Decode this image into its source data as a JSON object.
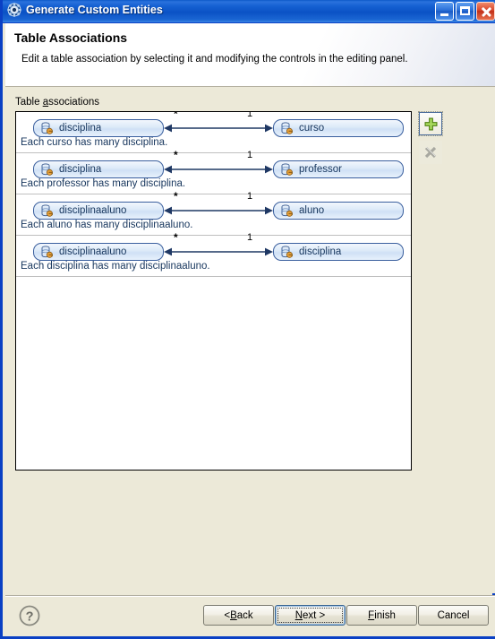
{
  "window": {
    "title": "Generate Custom Entities",
    "icon": "gear-icon",
    "minimize_label": "Minimize",
    "maximize_label": "Maximize",
    "close_label": "Close"
  },
  "banner": {
    "title": "Table Associations",
    "description": "Edit a table association by selecting it and modifying the controls in the editing panel."
  },
  "group": {
    "label_prefix": "Table ",
    "label_mnemonic": "a",
    "label_suffix": "ssociations"
  },
  "associations": [
    {
      "left_entity": "disciplina",
      "right_entity": "curso",
      "left_cardinality": "*",
      "right_cardinality": "1",
      "description": "Each curso has many disciplina."
    },
    {
      "left_entity": "disciplina",
      "right_entity": "professor",
      "left_cardinality": "*",
      "right_cardinality": "1",
      "description": "Each professor has many disciplina."
    },
    {
      "left_entity": "disciplinaaluno",
      "right_entity": "aluno",
      "left_cardinality": "*",
      "right_cardinality": "1",
      "description": "Each aluno has many disciplinaaluno."
    },
    {
      "left_entity": "disciplinaaluno",
      "right_entity": "disciplina",
      "left_cardinality": "*",
      "right_cardinality": "1",
      "description": "Each disciplina has many disciplinaaluno."
    }
  ],
  "side_tools": {
    "add": {
      "name": "add-association-button",
      "icon": "plus-icon",
      "enabled": true
    },
    "remove": {
      "name": "remove-association-button",
      "icon": "x-icon",
      "enabled": false
    }
  },
  "buttons": {
    "help": "?",
    "back_prefix": "< ",
    "back_mnemonic": "B",
    "back_suffix": "ack",
    "next_mnemonic": "N",
    "next_suffix": "ext >",
    "finish_mnemonic": "F",
    "finish_suffix": "inish",
    "cancel": "Cancel"
  },
  "colors": {
    "titlebar_blue": "#0b52c5",
    "window_border": "#0a40c4",
    "dialog_bg": "#ece9d8",
    "entity_border": "#3a5f9e",
    "entity_text": "#17365d",
    "arrow": "#1f3864",
    "add_green": "#6cbe45",
    "close_red": "#c12f18"
  }
}
